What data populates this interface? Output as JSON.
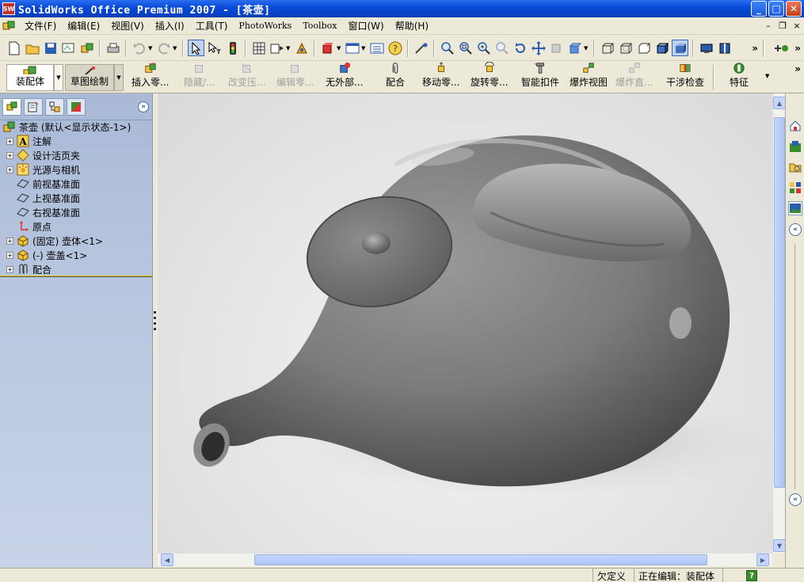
{
  "window": {
    "app_icon_text": "SW",
    "title": "SolidWorks Office Premium 2007 - [茶壶]",
    "min_label": "_",
    "max_label": "□",
    "close_label": "✕"
  },
  "menu": {
    "items": [
      "文件(F)",
      "编辑(E)",
      "视图(V)",
      "插入(I)",
      "工具(T)",
      "PhotoWorks",
      "Toolbox",
      "窗口(W)",
      "帮助(H)"
    ],
    "mdi_min": "–",
    "mdi_restore": "❐",
    "mdi_close": "×"
  },
  "toolbar_more": "»",
  "command_manager": {
    "tabs": [
      {
        "label": "装配体"
      },
      {
        "label": "草图绘制"
      }
    ],
    "buttons": [
      {
        "label": "插入零...",
        "enabled": true
      },
      {
        "label": "隐藏/...",
        "enabled": false
      },
      {
        "label": "改变压...",
        "enabled": false
      },
      {
        "label": "编辑零...",
        "enabled": false
      },
      {
        "label": "无外部...",
        "enabled": true
      },
      {
        "label": "配合",
        "enabled": true
      },
      {
        "label": "移动零...",
        "enabled": true
      },
      {
        "label": "旋转零...",
        "enabled": true
      },
      {
        "label": "智能扣件",
        "enabled": true
      },
      {
        "label": "爆炸视图",
        "enabled": true
      },
      {
        "label": "爆炸直...",
        "enabled": false
      },
      {
        "label": "干涉检查",
        "enabled": true
      },
      {
        "label": "特征",
        "enabled": true
      }
    ]
  },
  "feature_tree": {
    "expand_label": "»",
    "root": "茶壶  (默认<显示状态-1>)",
    "items": [
      {
        "label": "注解",
        "expandable": true,
        "icon": "annotation-icon"
      },
      {
        "label": "设计活页夹",
        "expandable": true,
        "icon": "design-binder-icon"
      },
      {
        "label": "光源与相机",
        "expandable": true,
        "icon": "lights-cameras-icon"
      },
      {
        "label": "前视基准面",
        "expandable": false,
        "icon": "plane-icon"
      },
      {
        "label": "上视基准面",
        "expandable": false,
        "icon": "plane-icon"
      },
      {
        "label": "右视基准面",
        "expandable": false,
        "icon": "plane-icon"
      },
      {
        "label": "原点",
        "expandable": false,
        "icon": "origin-icon"
      },
      {
        "label": "(固定) 壶体<1>",
        "expandable": true,
        "icon": "part-icon"
      },
      {
        "label": "(-) 壶盖<1>",
        "expandable": true,
        "icon": "part-icon"
      },
      {
        "label": "配合",
        "expandable": true,
        "icon": "mates-icon"
      }
    ]
  },
  "status": {
    "definition": "欠定义",
    "editing": "正在编辑：装配体",
    "help": "?"
  },
  "colors": {
    "titlebar": "#0a4cd8",
    "panel": "#ece9d8",
    "tree_bg": "#b8c6df",
    "rollback": "#e0c800"
  }
}
